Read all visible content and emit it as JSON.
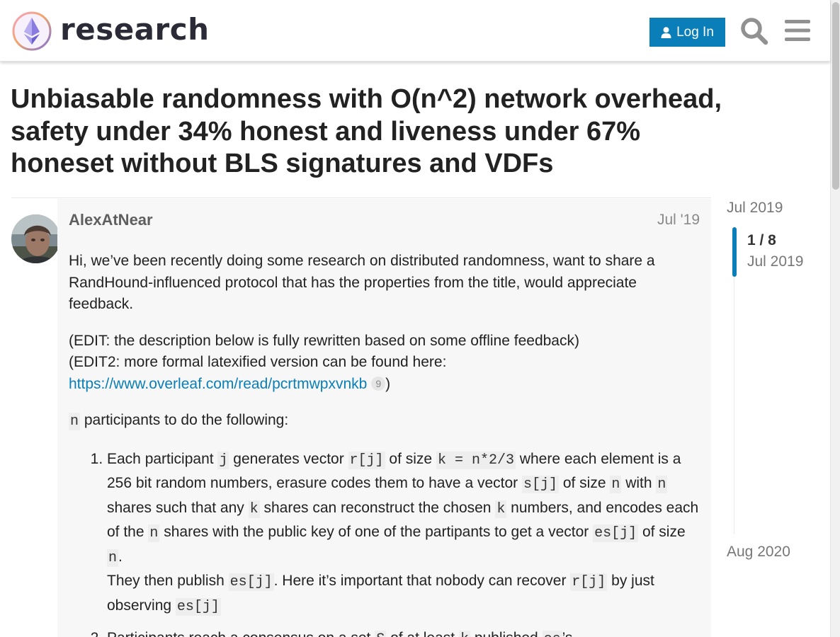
{
  "header": {
    "site_name": "research",
    "login_label": "Log In",
    "icons": [
      "ethereum-research-logo-icon",
      "user-icon",
      "search-icon",
      "hamburger-menu-icon"
    ],
    "accent_color": "#0a7eb8"
  },
  "topic": {
    "title": "Unbiasable randomness with O(n^2) network overhead, safety under 34% honest and liveness under 67% honeset without BLS signatures and VDFs"
  },
  "post": {
    "username": "AlexAtNear",
    "date": "Jul '19",
    "paragraphs": {
      "p1": "Hi, we’ve been recently doing some research on distributed randomness, want to share a RandHound-influenced protocol that has the properties from the title, would appreciate feedback.",
      "edit1": "(EDIT: the description below is fully rewritten based on some offline feedback)",
      "edit2": "(EDIT2: more formal latexified version can be found here:",
      "link_text": "https://www.overleaf.com/read/pcrtmwpxvnkb",
      "link_clicks": "9",
      "close_paren": ")",
      "intro_code": "n",
      "intro_text": " participants to do the following:"
    },
    "list": {
      "item1": {
        "t1": "Each participant ",
        "c1": "j",
        "t2": " generates vector ",
        "c2": "r[j]",
        "t3": " of size ",
        "c3": "k = n*2/3",
        "t4": " where each element is a 256 bit random numbers, erasure codes them to have a vector ",
        "c4": "s[j]",
        "t5": " of size ",
        "c5": "n",
        "t6": " with ",
        "c6": "n",
        "t7": " shares such that any ",
        "c7": "k",
        "t8": " shares can reconstruct the chosen ",
        "c8": "k",
        "t9": " numbers, and encodes each of the ",
        "c9": "n",
        "t10": " shares with the public key of one of the partipants to get a vector ",
        "c10": "es[j]",
        "t11": " of size ",
        "c11": "n",
        "t12": ".",
        "t13": "They then publish ",
        "c12": "es[j]",
        "t14": ". Here it’s important that nobody can recover ",
        "c13": "r[j]",
        "t15": " by just observing ",
        "c14": "es[j]"
      },
      "item2": {
        "t1": "Participants reach a consensus on a set ",
        "c1": "S",
        "t2": " of at least ",
        "c2": "k",
        "t3": " published ",
        "c3": "es",
        "t4": "’s."
      }
    }
  },
  "timeline": {
    "start": "Jul 2019",
    "position": "1 / 8",
    "position_fraction": 0.125,
    "current_date": "Jul 2019",
    "end": "Aug 2020"
  }
}
